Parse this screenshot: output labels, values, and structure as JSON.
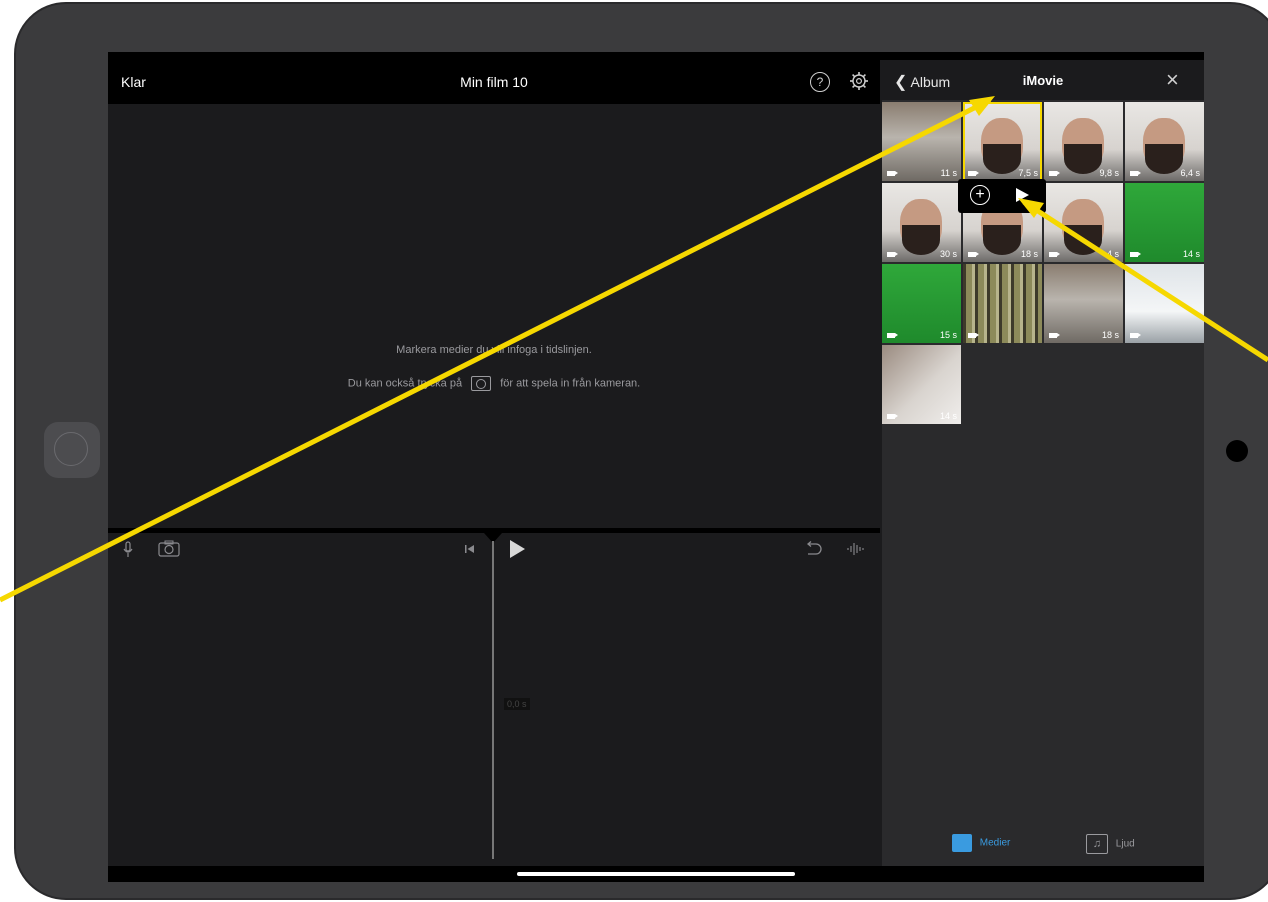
{
  "editor": {
    "done_label": "Klar",
    "title": "Min film 10",
    "help_symbol": "?",
    "hint_line1": "Markera medier du vill infoga i tidslinjen.",
    "hint_line2_before": "Du kan också trycka på",
    "hint_line2_after": "för att spela in från kameran.",
    "timecode": "0,0 s"
  },
  "media_panel": {
    "back_label": "Album",
    "title": "iMovie",
    "close_symbol": "×",
    "thumbnails": [
      {
        "duration": "11 s",
        "kind": "gym"
      },
      {
        "duration": "7,5 s",
        "kind": "face"
      },
      {
        "duration": "9,8 s",
        "kind": "face"
      },
      {
        "duration": "6,4 s",
        "kind": "face"
      },
      {
        "duration": "30 s",
        "kind": "face"
      },
      {
        "duration": "18 s",
        "kind": "face"
      },
      {
        "duration": "4 s",
        "kind": "face"
      },
      {
        "duration": "14 s",
        "kind": "green"
      },
      {
        "duration": "15 s",
        "kind": "green"
      },
      {
        "duration": "",
        "kind": "forest"
      },
      {
        "duration": "18 s",
        "kind": "gym"
      },
      {
        "duration": "",
        "kind": "snow"
      },
      {
        "duration": "14 s",
        "kind": "hand"
      }
    ],
    "tabs": [
      {
        "label": "Medier",
        "active": true
      },
      {
        "label": "Ljud",
        "active": false
      }
    ]
  },
  "colors": {
    "accent": "#3a9be0",
    "annotation_arrow": "#f6d800"
  }
}
